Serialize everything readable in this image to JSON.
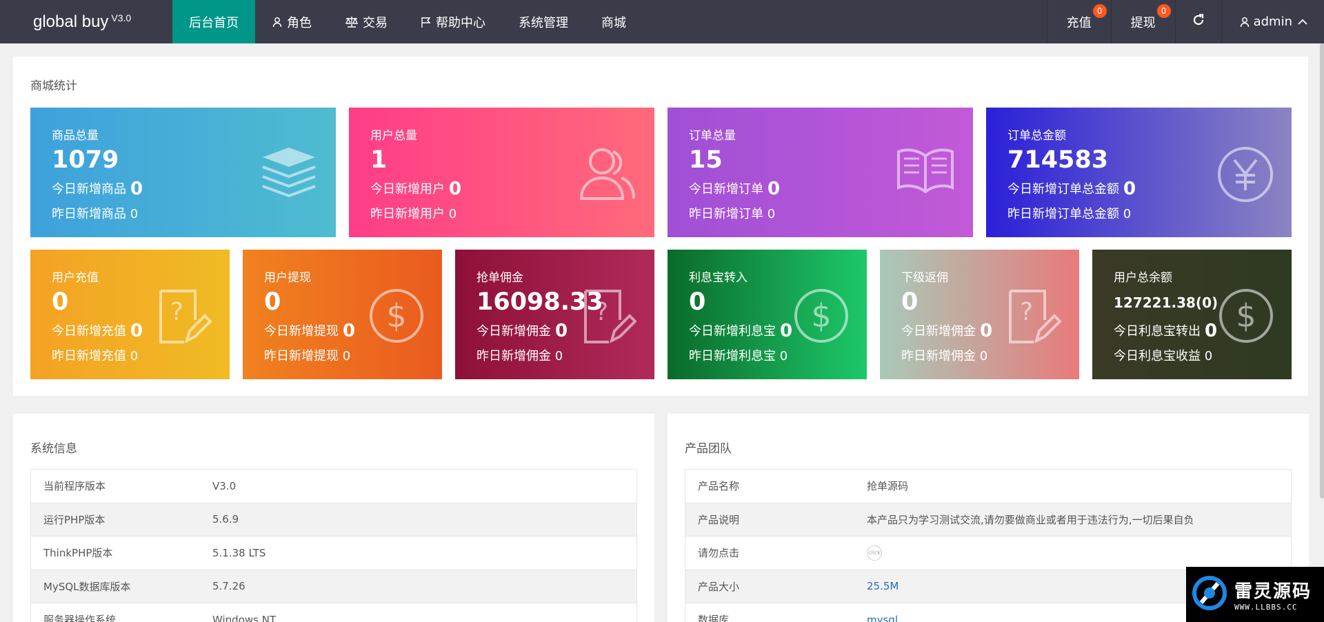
{
  "header": {
    "brand": "global buy",
    "version": "V3.0",
    "nav": [
      "后台首页",
      "角色",
      "交易",
      "帮助中心",
      "系统管理",
      "商城"
    ],
    "recharge": "充值",
    "recharge_badge": "0",
    "withdraw": "提现",
    "withdraw_badge": "0",
    "user": "admin"
  },
  "stats": {
    "title": "商城统计",
    "cards": [
      {
        "title": "商品总量",
        "value": "1079",
        "today_label": "今日新增商品",
        "today_value": "0",
        "yest_label": "昨日新增商品",
        "yest_value": "0",
        "icon": "layers-icon"
      },
      {
        "title": "用户总量",
        "value": "1",
        "today_label": "今日新增用户",
        "today_value": "0",
        "yest_label": "昨日新增用户",
        "yest_value": "0",
        "icon": "users-icon"
      },
      {
        "title": "订单总量",
        "value": "15",
        "today_label": "今日新增订单",
        "today_value": "0",
        "yest_label": "昨日新增订单",
        "yest_value": "0",
        "icon": "book-icon"
      },
      {
        "title": "订单总金额",
        "value": "714583",
        "today_label": "今日新增订单总金额",
        "today_value": "0",
        "yest_label": "昨日新增订单总金额",
        "yest_value": "0",
        "icon": "yen-icon"
      },
      {
        "title": "用户充值",
        "value": "0",
        "today_label": "今日新增充值",
        "today_value": "0",
        "yest_label": "昨日新增充值",
        "yest_value": "0",
        "icon": "note-question-icon"
      },
      {
        "title": "用户提现",
        "value": "0",
        "today_label": "今日新增提现",
        "today_value": "0",
        "yest_label": "昨日新增提现",
        "yest_value": "0",
        "icon": "dollar-icon"
      },
      {
        "title": "抢单佣金",
        "value": "16098.33",
        "today_label": "今日新增佣金",
        "today_value": "0",
        "yest_label": "昨日新增佣金",
        "yest_value": "0",
        "icon": "note-question-icon"
      },
      {
        "title": "利息宝转入",
        "value": "0",
        "today_label": "今日新增利息宝",
        "today_value": "0",
        "yest_label": "昨日新增利息宝",
        "yest_value": "0",
        "icon": "dollar-icon"
      },
      {
        "title": "下级返佣",
        "value": "0",
        "today_label": "今日新增佣金",
        "today_value": "0",
        "yest_label": "昨日新增佣金",
        "yest_value": "0",
        "icon": "note-question-icon"
      },
      {
        "title": "用户总余额",
        "value": "127221.38(0)",
        "today_label": "今日利息宝转出",
        "today_value": "0",
        "yest_label": "今日利息宝收益",
        "yest_value": "0",
        "icon": "dollar-icon"
      }
    ]
  },
  "system": {
    "title": "系统信息",
    "rows": [
      {
        "k": "当前程序版本",
        "v": "V3.0"
      },
      {
        "k": "运行PHP版本",
        "v": "5.6.9"
      },
      {
        "k": "ThinkPHP版本",
        "v": "5.1.38 LTS"
      },
      {
        "k": "MySQL数据库版本",
        "v": "5.7.26"
      },
      {
        "k": "服务器操作系统",
        "v": "Windows NT"
      }
    ]
  },
  "team": {
    "title": "产品团队",
    "rows": [
      {
        "k": "产品名称",
        "v": "抢单源码"
      },
      {
        "k": "产品说明",
        "v": "本产品只为学习测试交流,请勿要做商业或者用于违法行为,一切后果自负"
      },
      {
        "k": "请勿点击",
        "v": "click"
      },
      {
        "k": "产品大小",
        "v": "25.5M"
      },
      {
        "k": "数据库",
        "v": "mysql"
      }
    ]
  },
  "watermark": {
    "title": "雷灵源码",
    "url": "WWW.LLBBS.CC"
  },
  "colors": {
    "header_bg": "#3a3d49",
    "active_nav": "#009688",
    "badge": "#ff5722"
  }
}
